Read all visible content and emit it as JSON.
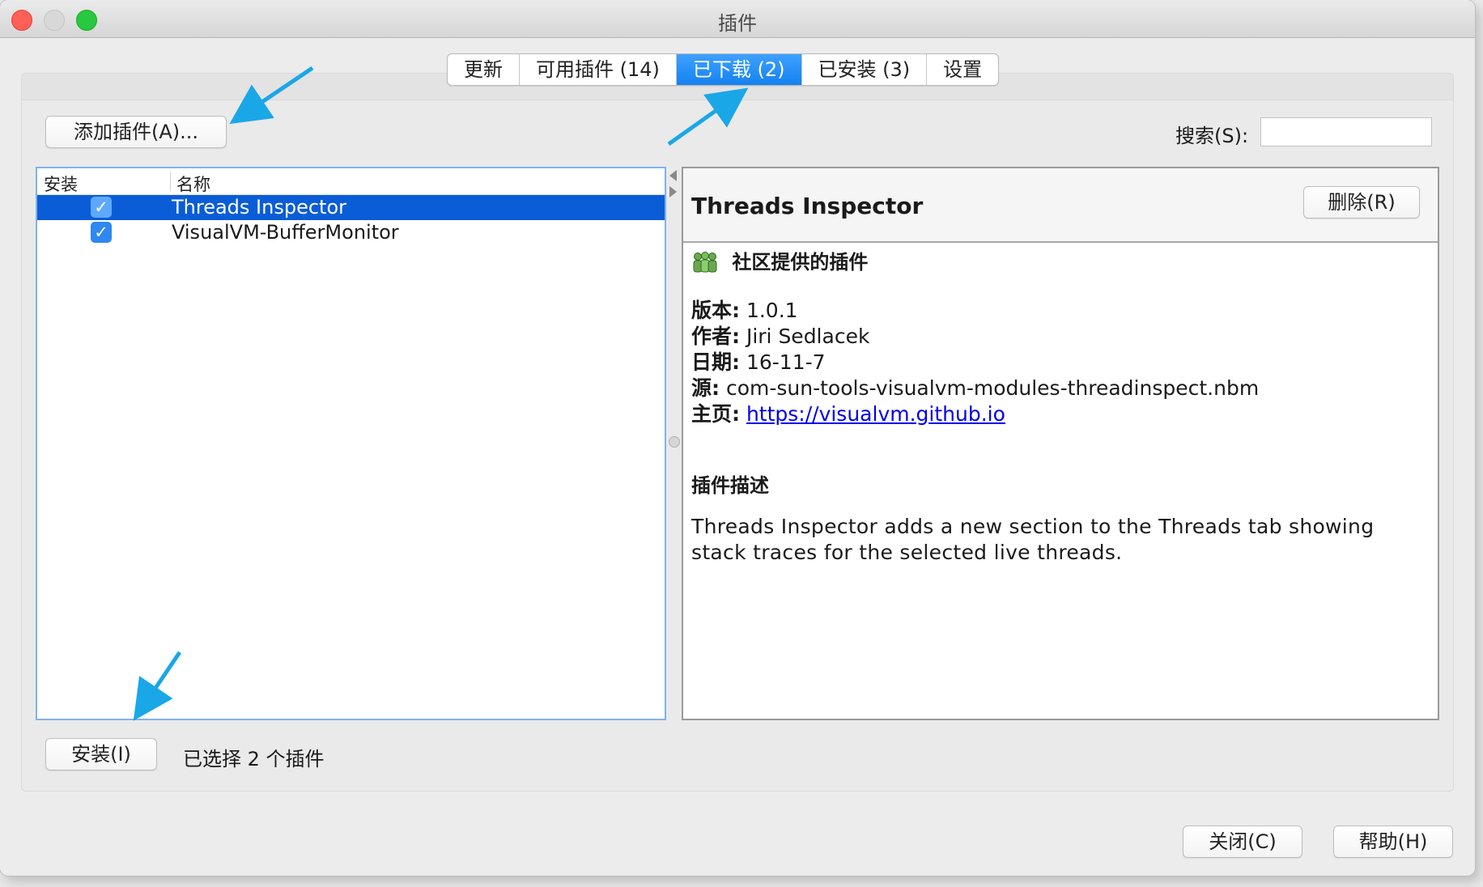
{
  "window": {
    "title": "插件"
  },
  "tabs": [
    {
      "label": "更新",
      "active": false
    },
    {
      "label": "可用插件 (14)",
      "active": false
    },
    {
      "label": "已下载 (2)",
      "active": true
    },
    {
      "label": "已安装 (3)",
      "active": false
    },
    {
      "label": "设置",
      "active": false
    }
  ],
  "toolbar": {
    "add_plugin_label": "添加插件(A)...",
    "search_label": "搜索(S):",
    "search_value": ""
  },
  "plugin_list": {
    "columns": [
      "安装",
      "名称"
    ],
    "rows": [
      {
        "name": "Threads Inspector",
        "checked": true,
        "selected": true
      },
      {
        "name": "VisualVM-BufferMonitor",
        "checked": true,
        "selected": false
      }
    ]
  },
  "detail": {
    "title": "Threads Inspector",
    "remove_label": "删除(R)",
    "community": "社区提供的插件",
    "version_label": "版本:",
    "version": "1.0.1",
    "author_label": "作者:",
    "author": "Jiri Sedlacek",
    "date_label": "日期:",
    "date": "16-11-7",
    "source_label": "源:",
    "source": "com-sun-tools-visualvm-modules-threadinspect.nbm",
    "homepage_label": "主页:",
    "homepage": "https://visualvm.github.io",
    "description_title": "插件描述",
    "description": "Threads Inspector adds a new section to the Threads tab showing stack traces for the selected live threads."
  },
  "footer": {
    "install_label": "安装(I)",
    "status": "已选择 2 个插件",
    "close_label": "关闭(C)",
    "help_label": "帮助(H)"
  },
  "icons": {
    "check": "✓",
    "community": "people-icon"
  },
  "colors": {
    "accent": "#1581f0",
    "selection": "#0a5dd6",
    "annotation_arrow": "#1aa7e8",
    "link": "#0000ee"
  }
}
